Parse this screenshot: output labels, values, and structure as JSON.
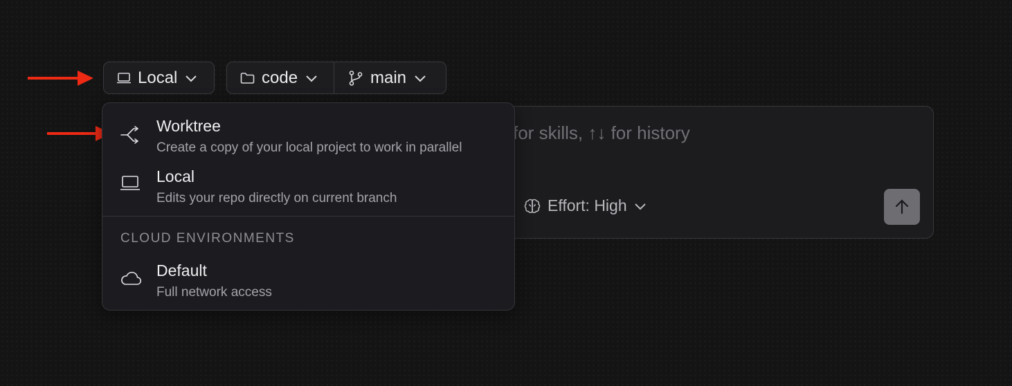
{
  "toolbar": {
    "environment": {
      "label": "Local",
      "icon": "laptop-icon"
    },
    "folder": {
      "label": "code",
      "icon": "folder-icon"
    },
    "branch": {
      "label": "main",
      "icon": "git-branch-icon"
    }
  },
  "composer": {
    "placeholder_visible": "for skills, ↑↓ for history",
    "effort_label": "Effort: High",
    "effort_icon": "brain-icon",
    "send_icon": "arrow-up-icon"
  },
  "menu": {
    "items": [
      {
        "title": "Worktree",
        "description": "Create a copy of your local project to work in parallel",
        "icon": "worktree-icon"
      },
      {
        "title": "Local",
        "description": "Edits your repo directly on current branch",
        "icon": "laptop-icon"
      }
    ],
    "section_header": "CLOUD ENVIRONMENTS",
    "cloud_items": [
      {
        "title": "Default",
        "description": "Full network access",
        "icon": "cloud-icon"
      }
    ]
  },
  "colors": {
    "background": "#141414",
    "annotation_arrow": "#ee2a15",
    "send_button": "#6e6e72"
  }
}
